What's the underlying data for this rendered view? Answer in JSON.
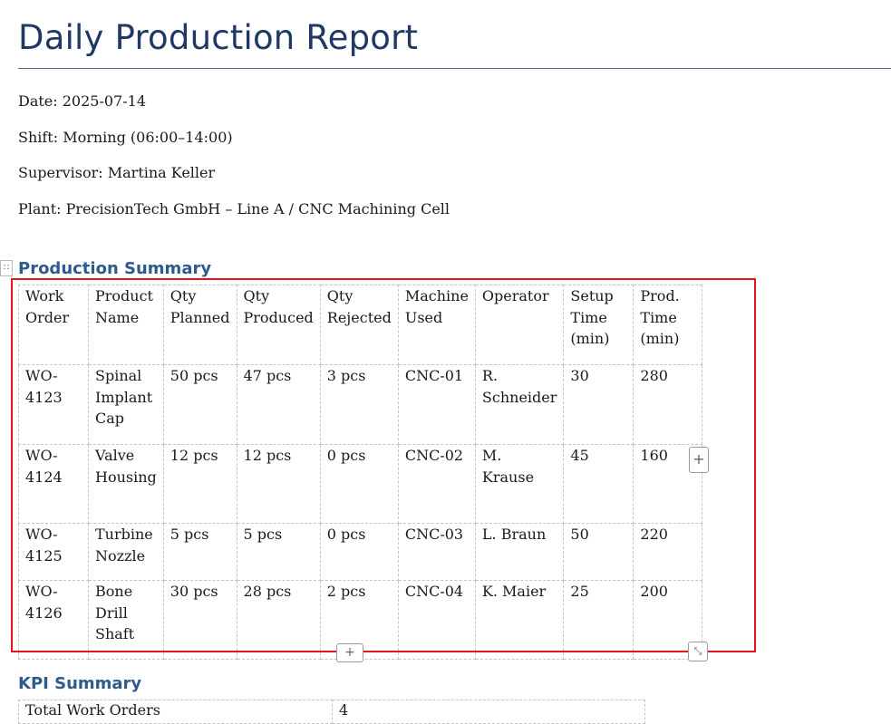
{
  "document": {
    "title": "Daily Production Report",
    "meta": {
      "date": "Date: 2025-07-14",
      "shift": "Shift: Morning (06:00–14:00)",
      "supervisor": "Supervisor: Martina Keller",
      "plant": "Plant: PrecisionTech GmbH – Line A / CNC Machining Cell"
    }
  },
  "production": {
    "heading": "Production Summary",
    "headers": [
      [
        "Work",
        "Order"
      ],
      [
        "Product",
        "Name"
      ],
      [
        "Qty",
        "Planned"
      ],
      [
        "Qty",
        "Produced"
      ],
      [
        "Qty",
        "Rejected"
      ],
      [
        "Machine",
        "Used"
      ],
      [
        "Operator"
      ],
      [
        "Setup",
        "Time",
        "(min)"
      ],
      [
        "Prod.",
        "Time",
        "(min)"
      ]
    ],
    "rows": [
      [
        [
          "WO-",
          "4123"
        ],
        [
          "Spinal",
          "Implant",
          "Cap"
        ],
        [
          "50 pcs"
        ],
        [
          "47 pcs"
        ],
        [
          "3 pcs"
        ],
        [
          "CNC-01"
        ],
        [
          "R.",
          "Schneider"
        ],
        [
          "30"
        ],
        [
          "280"
        ]
      ],
      [
        [
          "WO-",
          "4124"
        ],
        [
          "Valve",
          "Housing"
        ],
        [
          "12 pcs"
        ],
        [
          "12 pcs"
        ],
        [
          "0 pcs"
        ],
        [
          "CNC-02"
        ],
        [
          "M. Krause"
        ],
        [
          "45"
        ],
        [
          "160"
        ]
      ],
      [
        [
          "WO-",
          "4125"
        ],
        [
          "Turbine",
          "Nozzle"
        ],
        [
          "5 pcs"
        ],
        [
          "5 pcs"
        ],
        [
          "0 pcs"
        ],
        [
          "CNC-03"
        ],
        [
          "L. Braun"
        ],
        [
          "50"
        ],
        [
          "220"
        ]
      ],
      [
        [
          "WO-",
          "4126"
        ],
        [
          "Bone",
          "Drill",
          "Shaft"
        ],
        [
          "30 pcs"
        ],
        [
          "28 pcs"
        ],
        [
          "2 pcs"
        ],
        [
          "CNC-04"
        ],
        [
          "K. Maier"
        ],
        [
          "25"
        ],
        [
          "200"
        ]
      ]
    ]
  },
  "kpi": {
    "heading": "KPI Summary",
    "rows": [
      [
        "Total Work Orders",
        "4"
      ]
    ]
  },
  "controls": {
    "move_handle_icon": "∷",
    "add_column_icon": "+",
    "add_row_icon": "+",
    "resize_icon": "⤡"
  },
  "colors": {
    "heading": "#1f3864",
    "section_heading": "#2e5a8c",
    "selection_outline": "#e8141b"
  }
}
